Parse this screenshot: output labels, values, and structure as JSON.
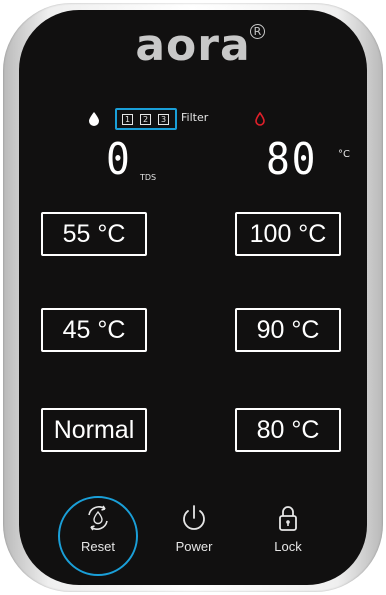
{
  "brand": {
    "name": "aora",
    "registered_mark": "R"
  },
  "status": {
    "filter_indicators": [
      "1",
      "2",
      "3"
    ],
    "filter_label": "Filter",
    "icons": {
      "water_drop": "water-drop-icon",
      "hot_drop": "hot-water-drop-icon"
    },
    "colors": {
      "highlight": "#1a9fd8",
      "hot": "#e0202a"
    }
  },
  "displays": {
    "tds": {
      "value": "0",
      "label": "TDS"
    },
    "temperature": {
      "value": "80",
      "unit": "°C"
    }
  },
  "temperature_buttons": {
    "left": [
      "55 °C",
      "45 °C",
      "Normal"
    ],
    "right": [
      "100 °C",
      "90 °C",
      "80 °C"
    ]
  },
  "controls": {
    "reset": {
      "label": "Reset",
      "icon": "reset-icon"
    },
    "power": {
      "label": "Power",
      "icon": "power-icon"
    },
    "lock": {
      "label": "Lock",
      "icon": "lock-icon"
    }
  }
}
